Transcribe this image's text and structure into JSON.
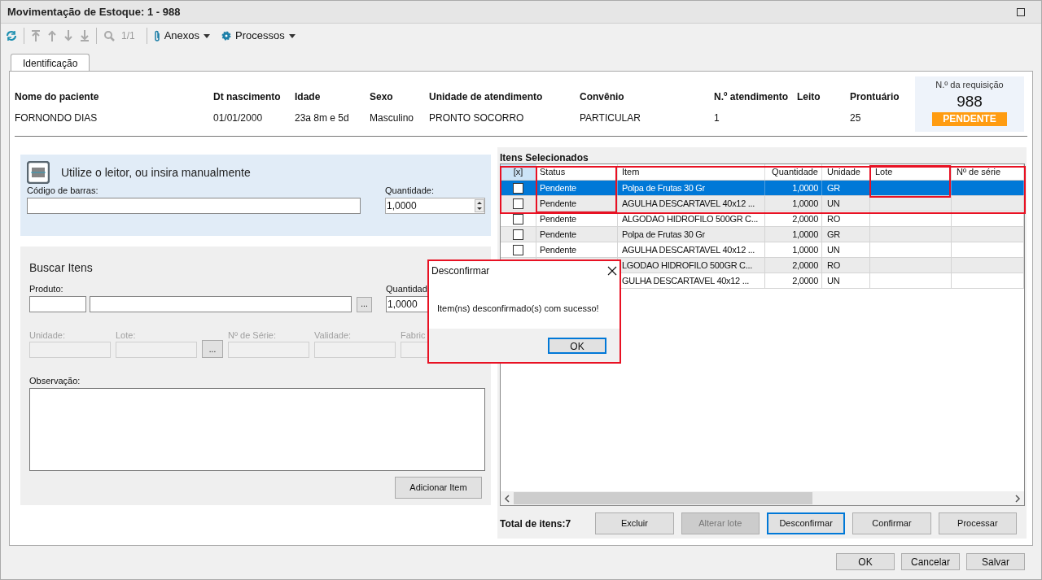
{
  "window": {
    "title": "Movimentação de Estoque: 1 - 988"
  },
  "toolbar": {
    "pager": "1/1",
    "menus": [
      {
        "label": "Anexos",
        "kind": "attach"
      },
      {
        "label": "Processos",
        "kind": "gear"
      }
    ]
  },
  "tabs": [
    {
      "label": "Identificação",
      "selected": true
    }
  ],
  "patient": [
    {
      "label": "Nome do paciente",
      "value": "FORNONDO DIAS"
    },
    {
      "label": "Dt nascimento",
      "value": "01/01/2000"
    },
    {
      "label": "Idade",
      "value": "23a 8m  e 5d"
    },
    {
      "label": "Sexo",
      "value": "Masculino"
    },
    {
      "label": "Unidade de atendimento",
      "value": "PRONTO SOCORRO"
    },
    {
      "label": "Convênio",
      "value": "PARTICULAR"
    },
    {
      "label": "N.º atendimento",
      "value": "1"
    },
    {
      "label": "Leito"
    },
    {
      "label": "Prontuário",
      "value": "25"
    }
  ],
  "requisition": {
    "label": "N.º da requisição",
    "number": "988",
    "status": "PENDENTE"
  },
  "barcode_panel": {
    "title": "Utilize o leitor, ou insira manualmente",
    "barcode_label": "Código de barras:",
    "quantity_label": "Quantidade:",
    "quantity": "1,0000"
  },
  "search_panel": {
    "title": "Buscar Itens",
    "product_label": "Produto:",
    "browse": "...",
    "quantity_label": "Quantidad",
    "quantity": "1,0000",
    "fields": [
      {
        "label": "Unidade:",
        "disabled": true
      },
      {
        "label": "Lote:",
        "disabled": true,
        "browse": "..."
      },
      {
        "label": "Nº de Série:",
        "disabled": true
      },
      {
        "label": "Validade:",
        "disabled": true
      },
      {
        "label": "Fabric",
        "disabled": true
      }
    ],
    "observation_label": "Observação:",
    "add_button": "Adicionar Item"
  },
  "grid": {
    "title": "Itens Selecionados",
    "columns": [
      "[x]",
      "Status",
      "Item",
      "Quantidade",
      "Unidade",
      "Lote",
      "Nº de série"
    ],
    "rows": [
      {
        "checked": false,
        "selected": true,
        "status": "Pendente",
        "item": "Polpa de Frutas 30 Gr",
        "quantity": "1,0000",
        "unit": "GR"
      },
      {
        "checked": false,
        "selected": false,
        "status": "Pendente",
        "item": "AGULHA DESCARTAVEL 40x12 ...",
        "quantity": "1,0000",
        "unit": "UN"
      },
      {
        "checked": false,
        "selected": false,
        "status": "Pendente",
        "item": "ALGODAO HIDROFILO 500GR C...",
        "quantity": "2,0000",
        "unit": "RO"
      },
      {
        "checked": false,
        "selected": false,
        "status": "Pendente",
        "item": "Polpa de Frutas 30 Gr",
        "quantity": "1,0000",
        "unit": "GR"
      },
      {
        "checked": false,
        "selected": false,
        "status": "Pendente",
        "item": "AGULHA DESCARTAVEL 40x12 ...",
        "quantity": "1,0000",
        "unit": "UN"
      },
      {
        "selected": false,
        "item": "LGODAO HIDROFILO 500GR C...",
        "quantity": "2,0000",
        "unit": "RO"
      },
      {
        "selected": false,
        "item": "GULHA DESCARTAVEL 40x12 ...",
        "quantity": "2,0000",
        "unit": "UN"
      }
    ]
  },
  "total": "Total de itens:7",
  "actions": [
    {
      "label": "Excluir",
      "disabled": false,
      "focused": false
    },
    {
      "label": "Alterar lote",
      "disabled": true,
      "focused": false
    },
    {
      "label": "Desconfirmar",
      "disabled": false,
      "focused": true
    },
    {
      "label": "Confirmar",
      "disabled": false,
      "focused": false
    },
    {
      "label": "Processar",
      "disabled": false,
      "focused": false
    }
  ],
  "footer_buttons": [
    "OK",
    "Cancelar",
    "Salvar"
  ],
  "dialog": {
    "title": "Desconfirmar",
    "message": "Item(ns) desconfirmado(s) com sucesso!",
    "button": "OK"
  }
}
